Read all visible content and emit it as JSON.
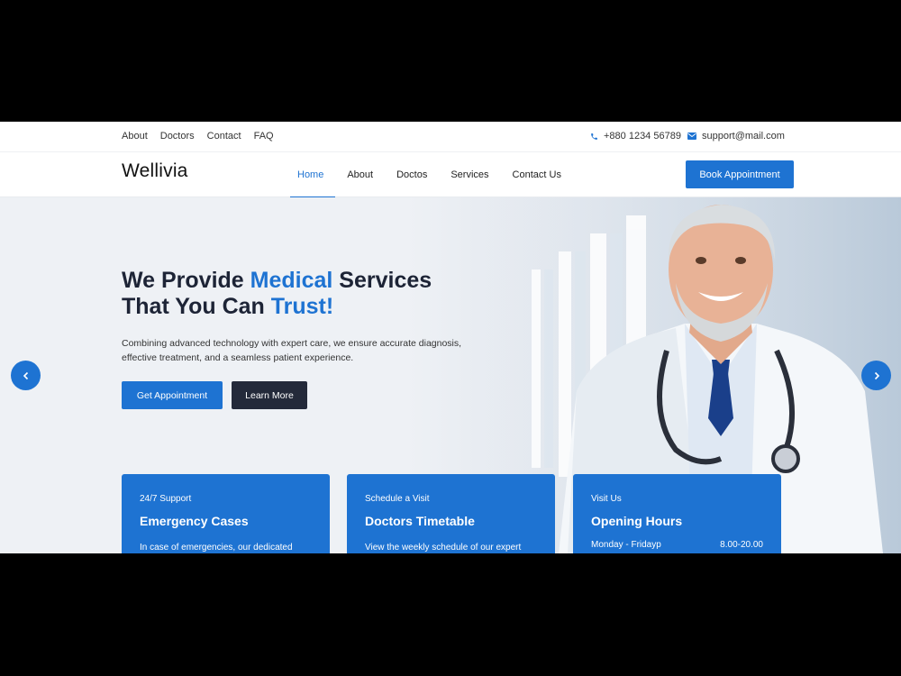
{
  "topbar": {
    "links": [
      "About",
      "Doctors",
      "Contact",
      "FAQ"
    ],
    "phone": "+880 1234 56789",
    "email": "support@mail.com"
  },
  "nav": {
    "logo": "Wellivia",
    "items": [
      "Home",
      "About",
      "Doctos",
      "Services",
      "Contact Us"
    ],
    "active": "Home",
    "cta": "Book Appointment"
  },
  "hero": {
    "title_part1": "We Provide ",
    "title_hl1": "Medical",
    "title_part2": " Services",
    "title_part3": "That You Can ",
    "title_hl2": "Trust!",
    "description": "Combining advanced technology with expert care, we ensure accurate diagnosis, effective treatment, and a seamless patient experience.",
    "primary_button": "Get Appointment",
    "secondary_button": "Learn More"
  },
  "cards": [
    {
      "small": "24/7 Support",
      "title": "Emergency Cases",
      "desc": "In case of emergencies, our dedicated"
    },
    {
      "small": "Schedule a Visit",
      "title": "Doctors Timetable",
      "desc": "View the weekly schedule of our expert"
    },
    {
      "small": "Visit Us",
      "title": "Opening Hours",
      "hours_day": "Monday - Fridayp",
      "hours_time": "8.00-20.00"
    }
  ],
  "icons": {
    "prev": "chevron-left-icon",
    "next": "chevron-right-icon",
    "phone": "phone-icon",
    "email": "envelope-icon"
  },
  "colors": {
    "accent": "#1e73d2",
    "dark": "#242a3a",
    "heading": "#1d2436"
  }
}
